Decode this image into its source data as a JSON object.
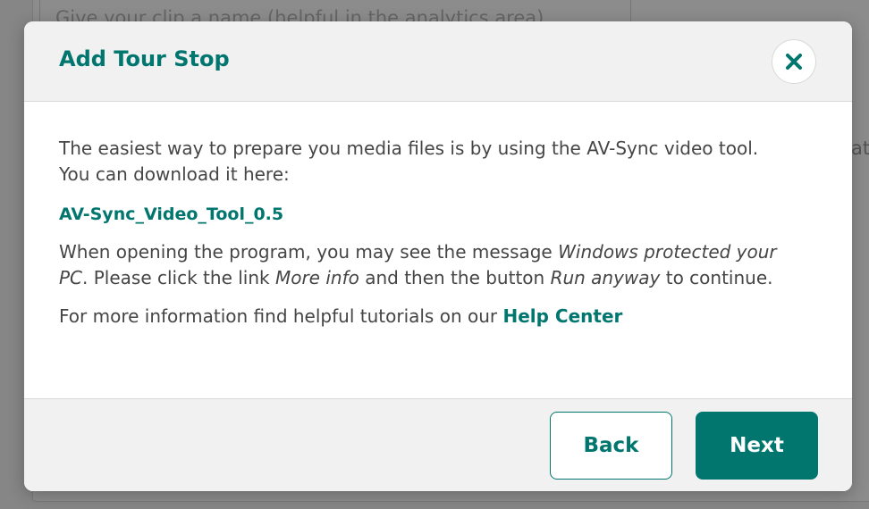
{
  "background": {
    "field_placeholder": "Give your clip a name (helpful in the analytics area)",
    "side_text": "at"
  },
  "modal": {
    "title": "Add Tour Stop",
    "close_icon": "close-icon",
    "intro_text": "The easiest way to prepare you media files is by using the AV-Sync video tool. You can download it here:",
    "download_link": "AV-Sync_Video_Tool_0.5",
    "warning": {
      "part1": "When opening the program, you may see the message ",
      "em1": "Windows protected your PC",
      "part2": ". Please click the link ",
      "em2": "More info",
      "part3": " and then the button ",
      "em3": "Run anyway",
      "part4": " to continue."
    },
    "help": {
      "text": "For more information find helpful tutorials on our ",
      "link": "Help Center"
    },
    "buttons": {
      "back": "Back",
      "next": "Next"
    }
  },
  "colors": {
    "accent": "#00766f",
    "text": "#454545",
    "header_bg": "#f1f1f1"
  }
}
